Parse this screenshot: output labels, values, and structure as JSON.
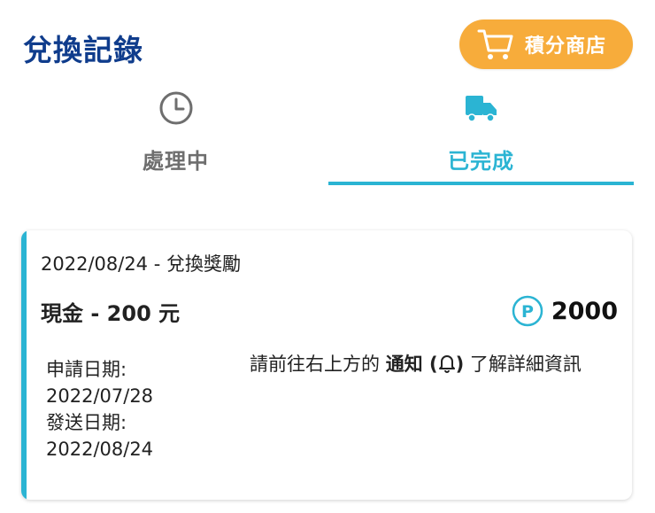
{
  "header": {
    "title": "兌換記錄",
    "shop_button_label": "積分商店",
    "shop_icon": "cart-icon"
  },
  "tabs": [
    {
      "label": "處理中",
      "icon": "clock-icon",
      "active": false
    },
    {
      "label": "已完成",
      "icon": "truck-icon",
      "active": true
    }
  ],
  "colors": {
    "title": "#0f3c8c",
    "shop_button": "#f7ac3b",
    "accent": "#2bb4d3",
    "inactive_tab": "#6e6e6e"
  },
  "record": {
    "date_line": "2022/08/24 - 兌換獎勵",
    "item": "現金 - 200 元",
    "points_icon": "points-p-icon",
    "points": "2000",
    "apply_label": "申請日期:",
    "apply_date": "2022/07/28",
    "send_label": "發送日期:",
    "send_date": "2022/08/24",
    "notice_prefix": "請前往右上方的 ",
    "notice_bold": "通知 (",
    "notice_bell_icon": "bell-icon",
    "notice_bold_end": ")",
    "notice_suffix": " 了解詳細資訊"
  }
}
